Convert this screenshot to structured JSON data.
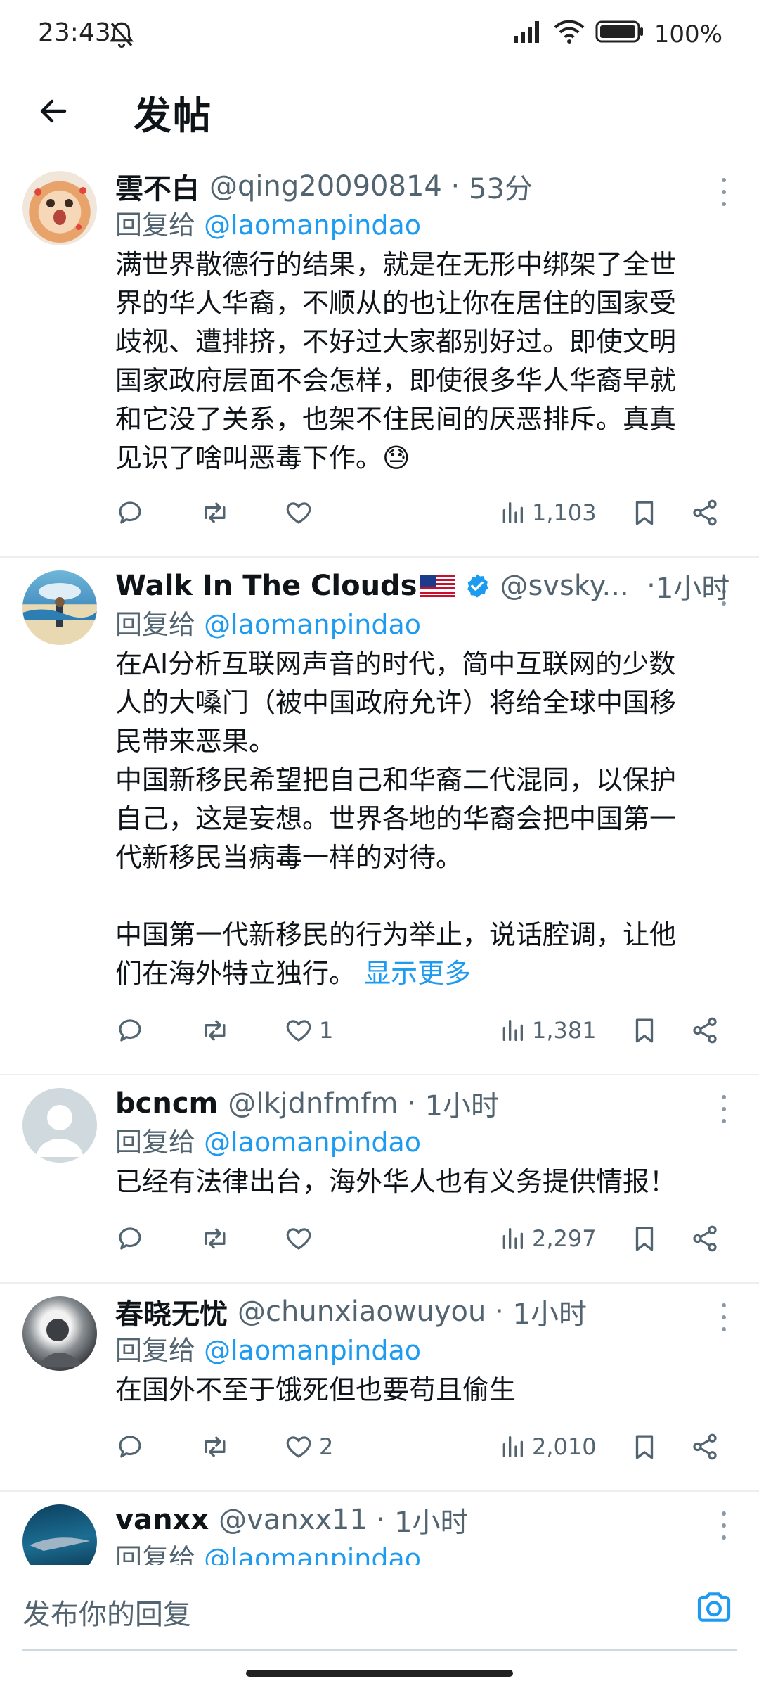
{
  "status_bar": {
    "time": "23:43",
    "battery": "100%"
  },
  "header": {
    "title": "发帖"
  },
  "posts": [
    {
      "name": "雲不白",
      "handle": "@qing20090814",
      "time": "53分",
      "reply_prefix": "回复给",
      "reply_to": "@laomanpindao",
      "text": "满世界散德行的结果，就是在无形中绑架了全世\n界的华人华裔，不顺从的也让你在居住的国家受\n歧视、遭排挤，不好过大家都别好过。即使文明\n国家政府层面不会怎样，即使很多华人华裔早就\n和它没了关系，也架不住民间的厌恶排斥。真真\n见识了啥叫恶毒下作。😓",
      "likes": "",
      "views": "1,103"
    },
    {
      "name": "Walk In The Clouds",
      "handle": "@svsky...",
      "time": "1小时",
      "reply_prefix": "回复给",
      "reply_to": "@laomanpindao",
      "text": "在AI分析互联网声音的时代，简中互联网的少数\n人的大嗓门（被中国政府允许）将给全球中国移\n民带来恶果。\n中国新移民希望把自己和华裔二代混同，以保护\n自己，这是妄想。世界各地的华裔会把中国第一\n代新移民当病毒一样的对待。\n\n中国第一代新移民的行为举止，说话腔调，让他\n们在海外特立独行。",
      "show_more": "显示更多",
      "likes": "1",
      "views": "1,381"
    },
    {
      "name": "bcncm",
      "handle": "@lkjdnfmfm",
      "time": "1小时",
      "reply_prefix": "回复给",
      "reply_to": "@laomanpindao",
      "text": "已经有法律出台，海外华人也有义务提供情报！",
      "likes": "",
      "views": "2,297"
    },
    {
      "name": "春晓无忧",
      "handle": "@chunxiaowuyou",
      "time": "1小时",
      "reply_prefix": "回复给",
      "reply_to": "@laomanpindao",
      "text": "在国外不至于饿死但也要苟且偷生",
      "likes": "2",
      "views": "2,010"
    },
    {
      "name": "vanxx",
      "handle": "@vanxx11",
      "time": "1小时",
      "reply_prefix": "回复给",
      "reply_to": "@laomanpindao"
    }
  ],
  "composer": {
    "placeholder": "发布你的回复"
  },
  "colors": {
    "link": "#1d9bf0",
    "secondary": "#536471",
    "text": "#0f1419"
  }
}
